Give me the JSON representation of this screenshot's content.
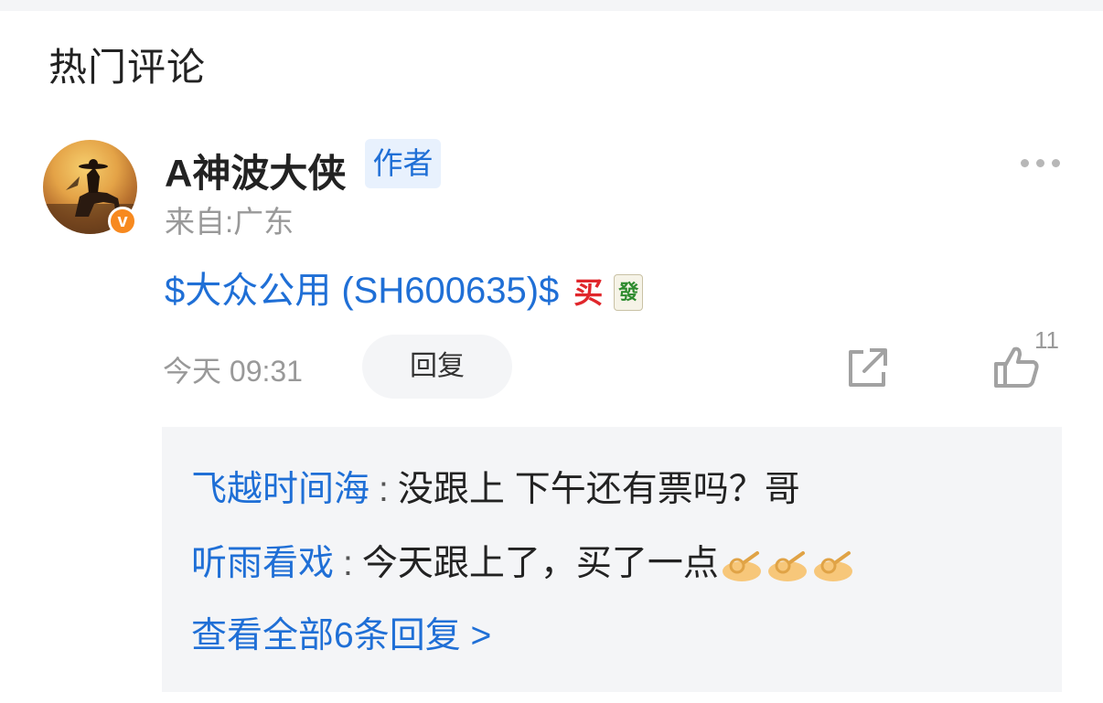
{
  "section_title": "热门评论",
  "comment": {
    "username": "A神波大侠",
    "author_tag": "作者",
    "location": "来自:广东",
    "content_link": "$大众公用 (SH600635)$",
    "emoji_buy": "买",
    "emoji_fa": "發",
    "timestamp": "今天 09:31",
    "reply_label": "回复",
    "like_count": "11"
  },
  "replies": [
    {
      "name": "飞越时间海",
      "separator": ":",
      "text": "没跟上 下午还有票吗？哥"
    },
    {
      "name": "听雨看戏",
      "separator": ":",
      "text": "今天跟上了，买了一点"
    }
  ],
  "view_all": "查看全部6条回复 >",
  "colors": {
    "link_blue": "#1f6fd6",
    "muted_gray": "#999999",
    "panel_bg": "#f4f5f7",
    "badge_orange": "#f7891f"
  },
  "icons": [
    "more-dots-icon",
    "share-icon",
    "thumbs-up-icon",
    "verified-v-icon",
    "ok-hand-emoji-icon"
  ]
}
